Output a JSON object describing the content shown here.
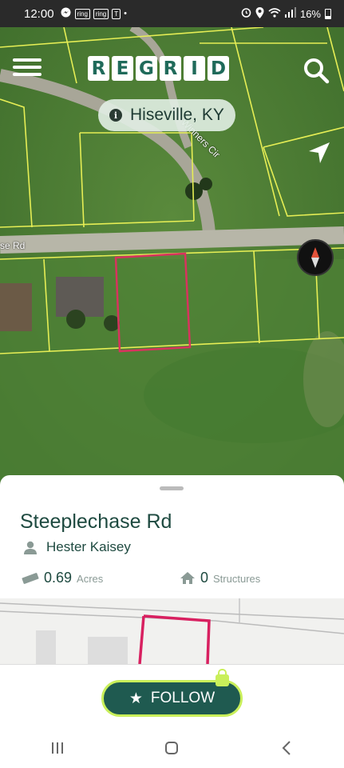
{
  "status_bar": {
    "time": "12:00",
    "notif_icons": [
      "messenger-icon",
      "ring-icon",
      "ring-icon",
      "t-icon"
    ],
    "ring1": "ring",
    "ring2": "ring",
    "t_label": "T",
    "dot": "•",
    "battery": "16%"
  },
  "header": {
    "logo_letters": [
      "R",
      "E",
      "G",
      "R",
      "I",
      "D"
    ],
    "location": "Hiseville, KY"
  },
  "map": {
    "road_labels": {
      "winners": "Winners Cir",
      "steeple": "se Rd"
    },
    "colors": {
      "parcel_line": "#e6ee55",
      "selected_parcel": "#d8335e",
      "road": "#b7b6a8"
    }
  },
  "parcel": {
    "title": "Steeplechase Rd",
    "owner": "Hester Kaisey",
    "acres_value": "0.69",
    "acres_unit": "Acres",
    "structures_value": "0",
    "structures_unit": "Structures"
  },
  "actions": {
    "follow_label": "FOLLOW",
    "follow_star": "★"
  },
  "theme": {
    "brand": "#1f6a5a",
    "accent": "#c9ef5a"
  }
}
